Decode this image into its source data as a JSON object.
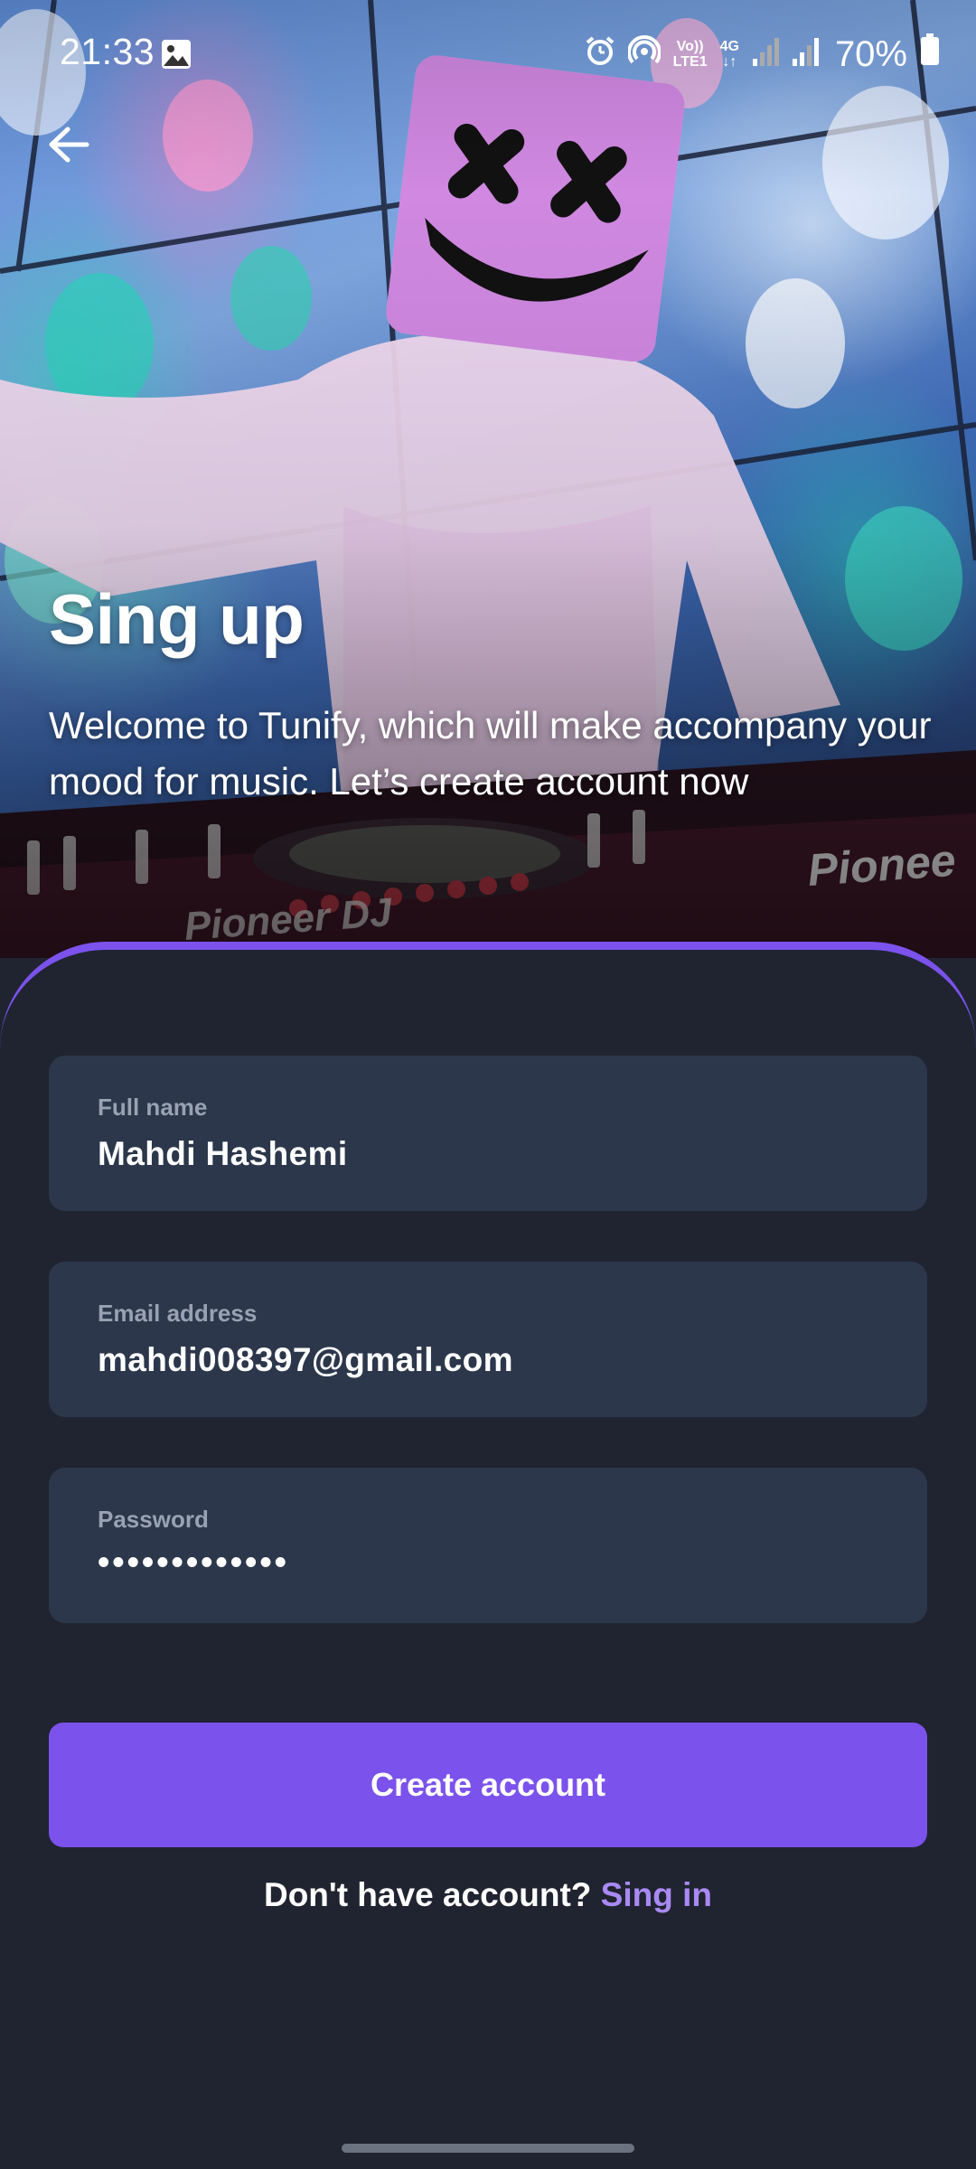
{
  "status_bar": {
    "time": "21:33",
    "network_top": "Vo))",
    "network_bottom": "LTE1",
    "data_type": "4G",
    "battery_percent": "70%",
    "icons": [
      "gallery-icon",
      "alarm-icon",
      "hotspot-icon",
      "signal-icon",
      "signal-icon",
      "battery-icon"
    ]
  },
  "header": {
    "back_icon": "arrow-left-icon",
    "title": "Sing up",
    "subtitle": "Welcome to Tunify, which will make accompany your mood for music. Let’s create account now"
  },
  "hero": {
    "description_visible_text": "Pioneer DJ"
  },
  "form": {
    "full_name": {
      "label": "Full name",
      "value": "Mahdi Hashemi"
    },
    "email": {
      "label": "Email address",
      "value": "mahdi008397@gmail.com"
    },
    "password": {
      "label": "Password",
      "value": "•••••••••••••"
    }
  },
  "actions": {
    "create_account_label": "Create account",
    "prompt_text": "Don't have account?",
    "sign_in_link": "Sing in"
  },
  "colors": {
    "accent": "#7b52ec",
    "link": "#a98af5",
    "background": "#1f2430",
    "field_background": "#2c374b",
    "label": "#98a2b3"
  }
}
